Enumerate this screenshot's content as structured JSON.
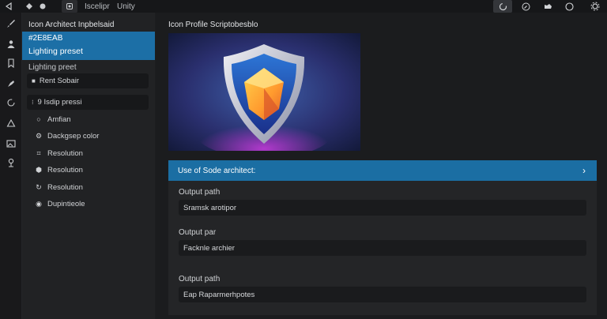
{
  "titlebar": {
    "app_name": "Iscelipr",
    "app_subtitle": "Unity",
    "left_icons": [
      "back-arrow-icon",
      "diamond-icon",
      "dot-icon",
      "app-logo-icon"
    ],
    "right_icons": [
      "spinner-icon",
      "compass-icon",
      "cloud-icon",
      "circle-icon",
      "settings-icon"
    ]
  },
  "activity_bar": {
    "icons": [
      "brush-icon",
      "person-icon",
      "bookmark-icon",
      "paint-icon",
      "refresh-icon",
      "triangle-icon",
      "image-icon",
      "pin-icon"
    ]
  },
  "sidebar": {
    "title": "Icon Architect Inpbelsaid",
    "active_item": {
      "line1": "#2E8EAB",
      "line2": "Lighting preset"
    },
    "section_label": "Lighting preet",
    "fields": [
      {
        "icon": "square-icon",
        "text": "Rent Sobair"
      },
      {
        "icon": "dots-icon",
        "text": "9 Isdip pressi"
      }
    ],
    "items": [
      {
        "icon": "lightbulb-icon",
        "label": "Amfian"
      },
      {
        "icon": "gear-icon",
        "label": "Dackgsep color"
      },
      {
        "icon": "crop-icon",
        "label": "Resolution"
      },
      {
        "icon": "hexagon-icon",
        "label": "Resolution"
      },
      {
        "icon": "refresh-icon",
        "label": "Resolution"
      },
      {
        "icon": "disk-icon",
        "label": "Dupintieole"
      }
    ]
  },
  "main": {
    "title": "Icon Profile Scriptobesblo",
    "preview_image": "shield-gem-icon",
    "banner": {
      "text": "Use of Sode architect:"
    },
    "fields": [
      {
        "label": "Output path",
        "value": "Sramsk arotipor"
      },
      {
        "label": "Output par",
        "value": "Facknle archier"
      },
      {
        "label": "Output path",
        "value": "Eap Raparmerhpotes"
      }
    ]
  },
  "colors": {
    "accent_blue": "#1c6fa6",
    "background": "#1d1e20",
    "sidebar": "#212224"
  }
}
